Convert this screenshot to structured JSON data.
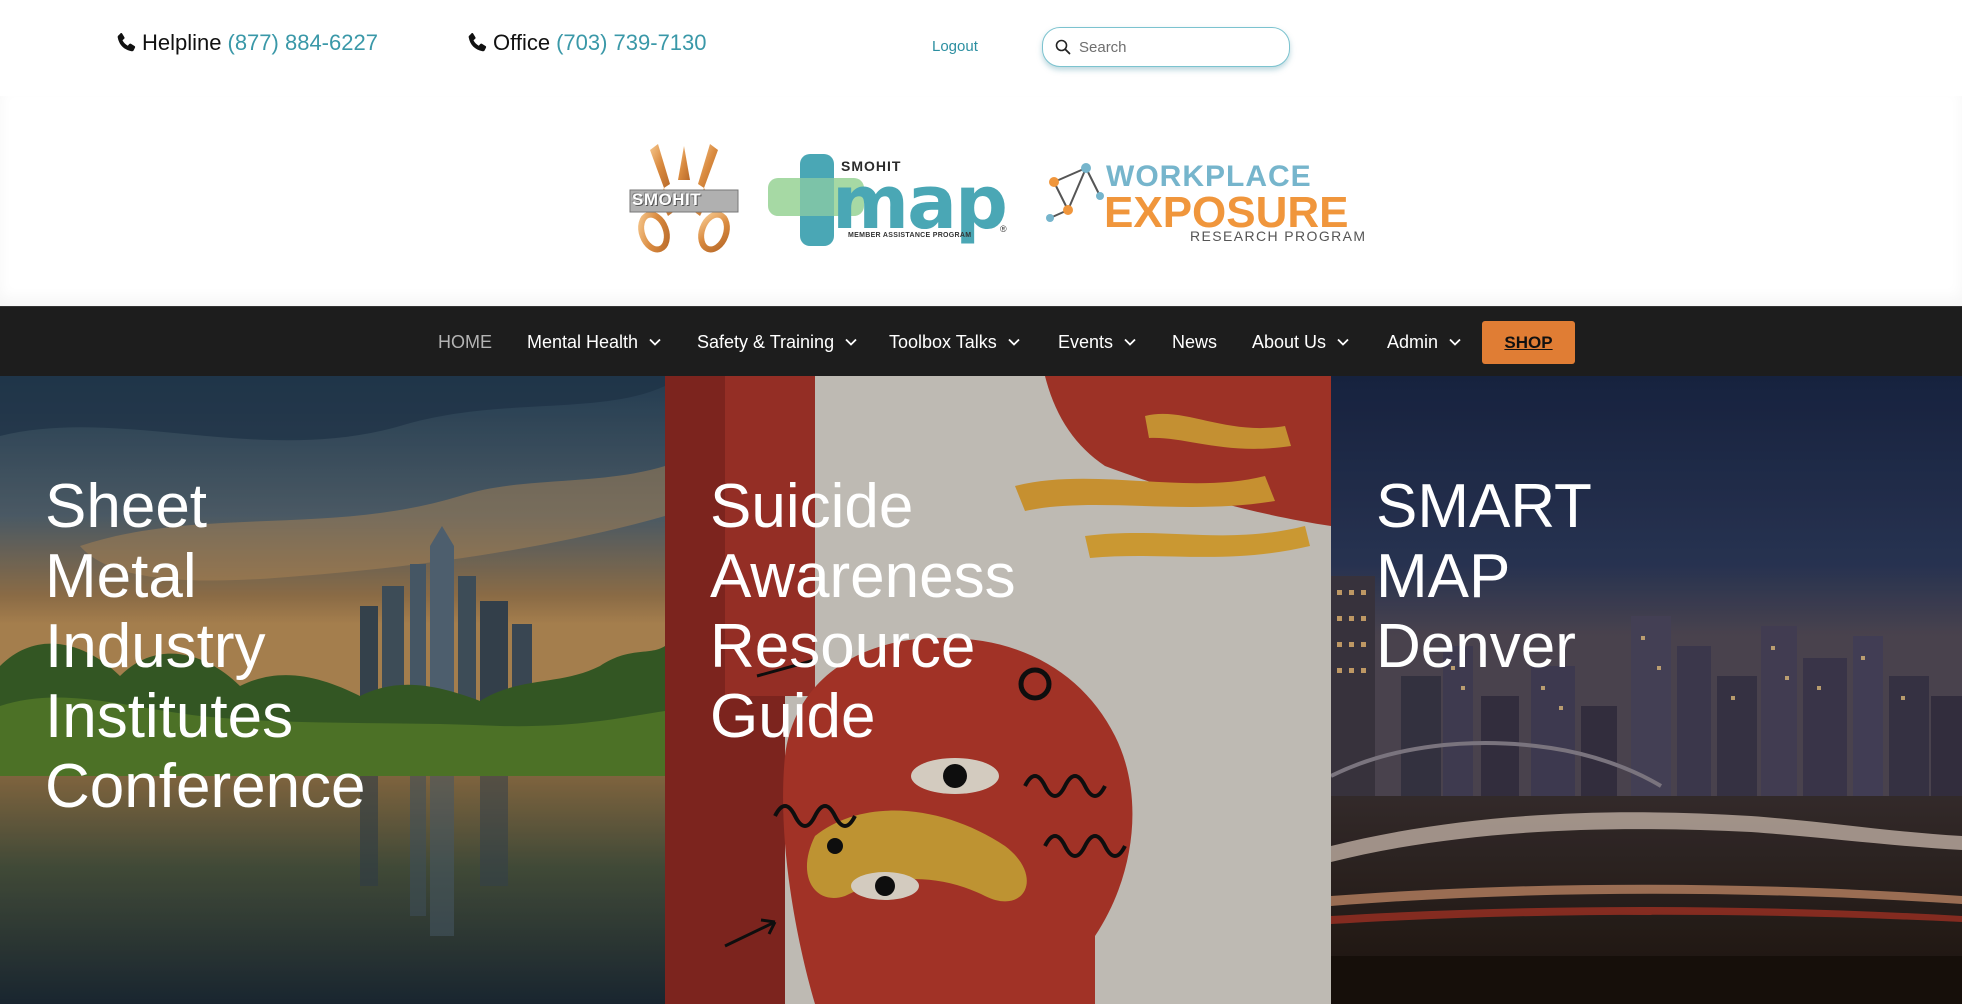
{
  "topbar": {
    "helpline_label": "Helpline",
    "helpline_number": "(877) 884-6227",
    "office_label": "Office",
    "office_number": "(703) 739-7130",
    "logout_label": "Logout",
    "search_placeholder": "Search"
  },
  "logos": {
    "smohit_text": "SMOHIT",
    "map_top": "SMOHIT",
    "map_big": "map",
    "map_sub": "MEMBER ASSISTANCE PROGRAM",
    "map_reg": "®",
    "wep_line1": "WORKPLACE",
    "wep_line2": "EXPOSURE",
    "wep_line3": "RESEARCH PROGRAM"
  },
  "nav": {
    "items": [
      {
        "label": "HOME",
        "dropdown": false
      },
      {
        "label": "Mental Health",
        "dropdown": true
      },
      {
        "label": "Safety & Training",
        "dropdown": true
      },
      {
        "label": "Toolbox Talks",
        "dropdown": true
      },
      {
        "label": "Events",
        "dropdown": true
      },
      {
        "label": "News",
        "dropdown": false
      },
      {
        "label": "About Us",
        "dropdown": true
      },
      {
        "label": "Admin",
        "dropdown": true
      }
    ],
    "shop_label": "SHOP"
  },
  "hero": {
    "panels": [
      {
        "lines": [
          "Sheet",
          "Metal",
          "Industry",
          "Institutes",
          "Conference"
        ]
      },
      {
        "lines": [
          "Suicide",
          "Awareness",
          "Resource",
          "Guide"
        ]
      },
      {
        "lines": [
          "SMART",
          "MAP",
          "Denver"
        ]
      }
    ]
  },
  "colors": {
    "accent_teal": "#3a98a8",
    "nav_bg": "#1d1d1d",
    "shop_orange": "#e07d34"
  }
}
